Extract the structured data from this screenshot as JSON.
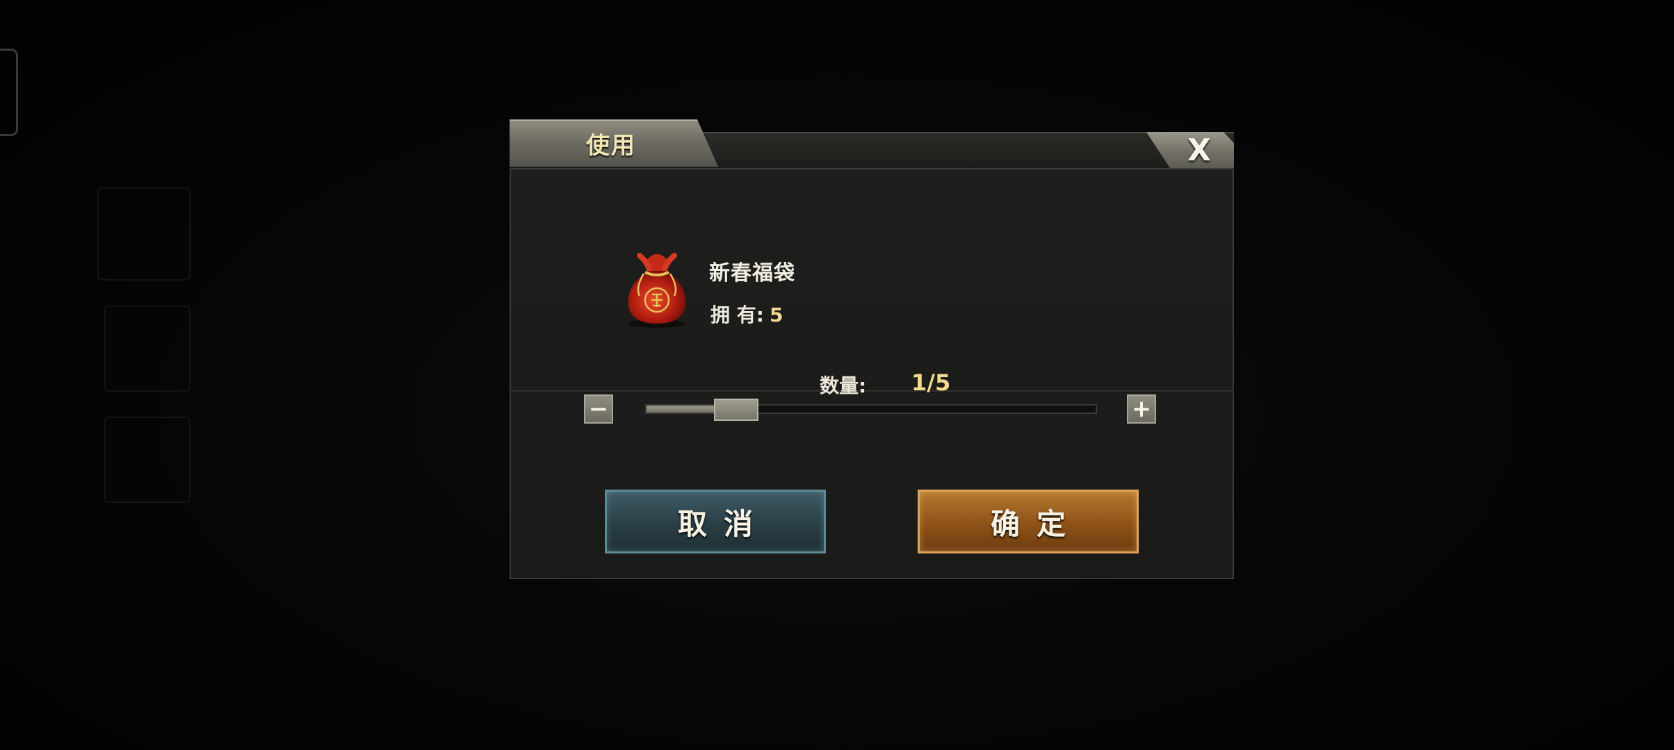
{
  "dialog": {
    "title": "使用",
    "close_label": "X"
  },
  "item": {
    "name": "新春福袋",
    "owned_label": "拥 有:",
    "owned_count": "5",
    "icon": "lucky-bag-icon"
  },
  "quantity": {
    "label": "数量:",
    "value": "1/5",
    "current": 1,
    "max": 5,
    "minus_label": "−",
    "plus_label": "+"
  },
  "buttons": {
    "cancel_label": "取消",
    "confirm_label": "确定"
  },
  "colors": {
    "accent_gold": "#f3dc8f",
    "cancel_blue": "#2a3f46",
    "confirm_orange": "#8e5218"
  }
}
